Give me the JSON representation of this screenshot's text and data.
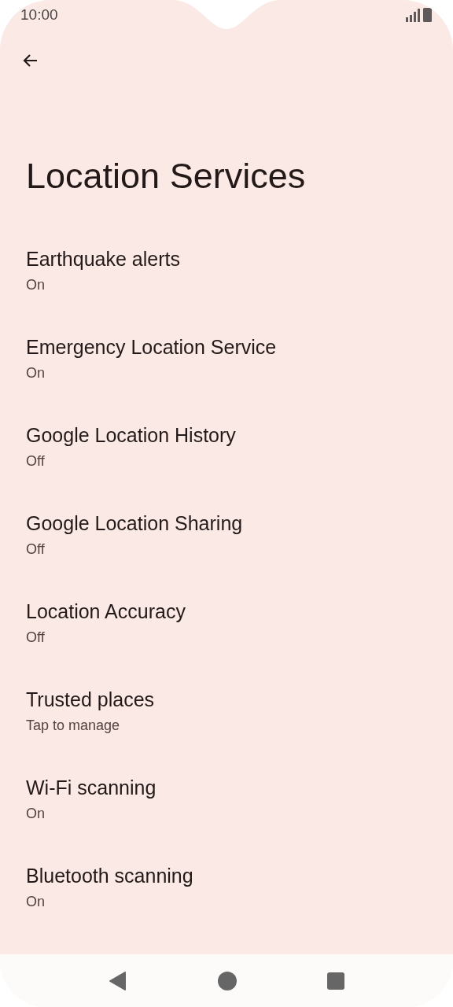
{
  "status_bar": {
    "time": "10:00"
  },
  "title": "Location Services",
  "items": [
    {
      "title": "Earthquake alerts",
      "summary": "On"
    },
    {
      "title": "Emergency Location Service",
      "summary": "On"
    },
    {
      "title": "Google Location History",
      "summary": "Off"
    },
    {
      "title": "Google Location Sharing",
      "summary": "Off"
    },
    {
      "title": "Location Accuracy",
      "summary": "Off"
    },
    {
      "title": "Trusted places",
      "summary": "Tap to manage"
    },
    {
      "title": "Wi-Fi scanning",
      "summary": "On"
    },
    {
      "title": "Bluetooth scanning",
      "summary": "On"
    }
  ]
}
